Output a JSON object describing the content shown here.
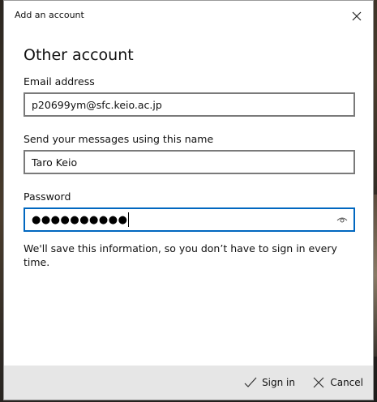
{
  "dialog": {
    "title": "Add an account",
    "heading": "Other account"
  },
  "email": {
    "label": "Email address",
    "value": "p20699ym@sfc.keio.ac.jp"
  },
  "display_name": {
    "label": "Send your messages using this name",
    "value": "Taro Keio"
  },
  "password": {
    "label": "Password",
    "masked_value": "●●●●●●●●●●"
  },
  "info": {
    "text": "We'll save this information, so you don’t have to sign in every time."
  },
  "footer": {
    "sign_in_label": "Sign in",
    "cancel_label": "Cancel"
  },
  "colors": {
    "accent": "#0067c0",
    "footer_bg": "#e6e6e6",
    "input_border": "#7a7a7a"
  },
  "icons": {
    "close": "close-icon",
    "reveal_password": "eye-icon",
    "sign_in": "checkmark-icon",
    "cancel": "x-icon"
  }
}
